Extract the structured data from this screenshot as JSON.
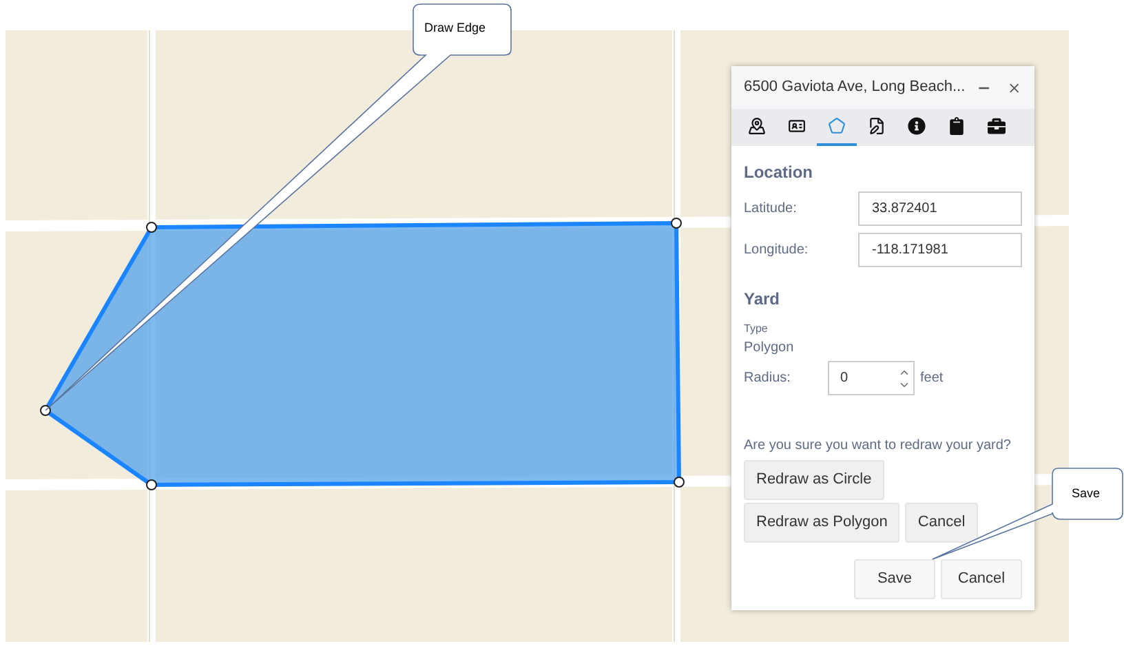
{
  "panel": {
    "title": "6500 Gaviota Ave, Long Beach...",
    "tabs": [
      {
        "kind": "location",
        "selected": false
      },
      {
        "kind": "card",
        "selected": false
      },
      {
        "kind": "polygon",
        "selected": true
      },
      {
        "kind": "edit",
        "selected": false
      },
      {
        "kind": "info",
        "selected": false
      },
      {
        "kind": "clipboard",
        "selected": false
      },
      {
        "kind": "briefcase",
        "selected": false
      }
    ],
    "location": {
      "heading": "Location",
      "fields": [
        {
          "label": "Latitude:",
          "value": "33.872401"
        },
        {
          "label": "Longitude:",
          "value": "-118.171981"
        }
      ]
    },
    "yard": {
      "heading": "Yard",
      "type_label": "Type",
      "type_value": "Polygon",
      "radius_label": "Radius:",
      "radius_value": "0",
      "radius_unit": "feet"
    },
    "confirm": {
      "question": "Are you sure you want to redraw your yard?",
      "buttons": [
        "Redraw as Circle",
        "Redraw as Polygon",
        "Cancel"
      ]
    },
    "footer_buttons": [
      "Save",
      "Cancel"
    ]
  },
  "callouts": [
    {
      "text": "Draw Edge"
    },
    {
      "text": "Save"
    }
  ]
}
